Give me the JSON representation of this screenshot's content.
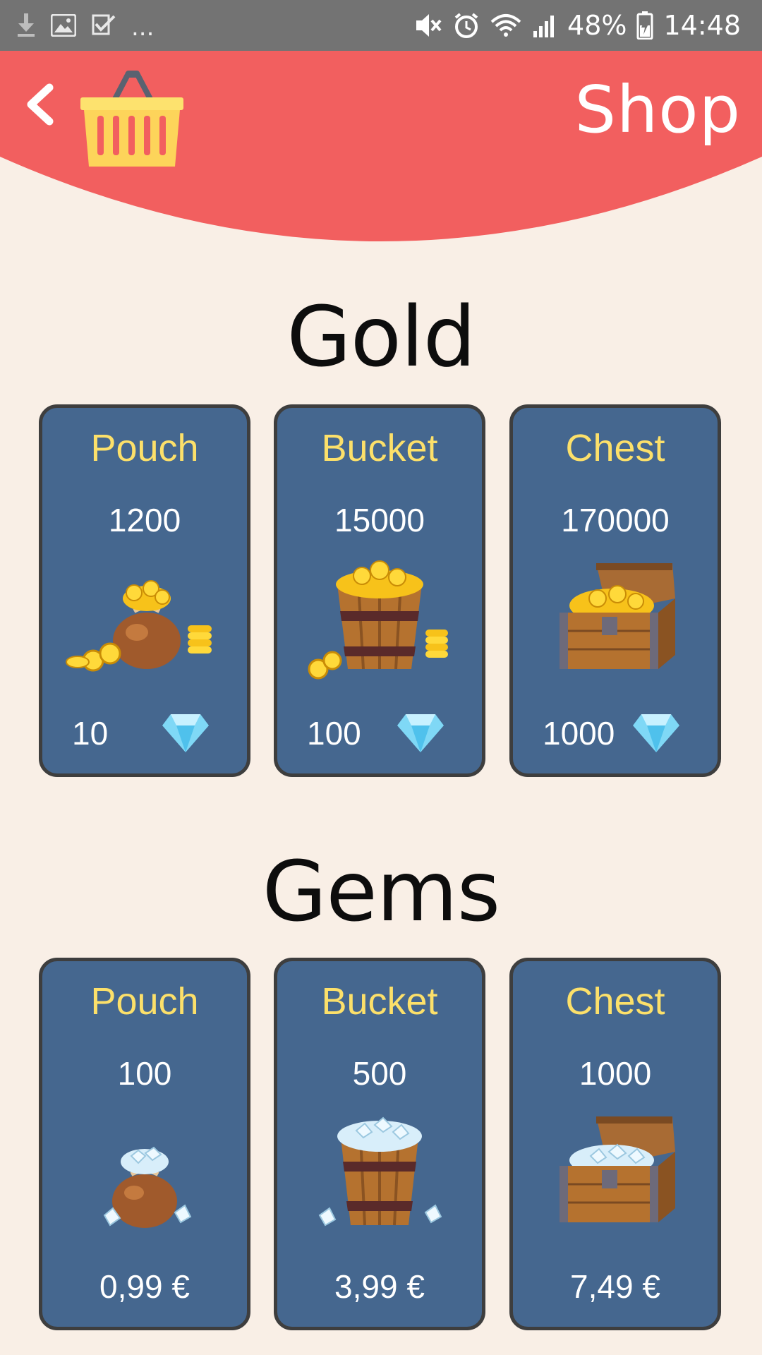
{
  "status_bar": {
    "icons_left": [
      "download-icon",
      "image-icon",
      "check-icon"
    ],
    "dots": "...",
    "icons_right": [
      "mute-icon",
      "alarm-icon",
      "wifi-icon",
      "signal-icon"
    ],
    "battery": "48%",
    "time": "14:48"
  },
  "header": {
    "title": "Shop",
    "back_icon": "chevron-left-icon",
    "logo_icon": "basket-icon",
    "color": "#f25f5f"
  },
  "gold": {
    "title": "Gold",
    "items": [
      {
        "name": "Pouch",
        "amount": "1200",
        "price": "10",
        "price_icon": "diamond-icon",
        "art": "gold-pouch"
      },
      {
        "name": "Bucket",
        "amount": "15000",
        "price": "100",
        "price_icon": "diamond-icon",
        "art": "gold-bucket"
      },
      {
        "name": "Chest",
        "amount": "170000",
        "price": "1000",
        "price_icon": "diamond-icon",
        "art": "gold-chest"
      }
    ]
  },
  "gems": {
    "title": "Gems",
    "items": [
      {
        "name": "Pouch",
        "amount": "100",
        "price": "0,99 €",
        "art": "gem-pouch"
      },
      {
        "name": "Bucket",
        "amount": "500",
        "price": "3,99 €",
        "art": "gem-bucket"
      },
      {
        "name": "Chest",
        "amount": "1000",
        "price": "7,49 €",
        "art": "gem-chest"
      }
    ]
  },
  "colors": {
    "background": "#f9efe6",
    "card": "#45678f",
    "card_border": "#3e3e3e",
    "item_name": "#fce06a"
  }
}
